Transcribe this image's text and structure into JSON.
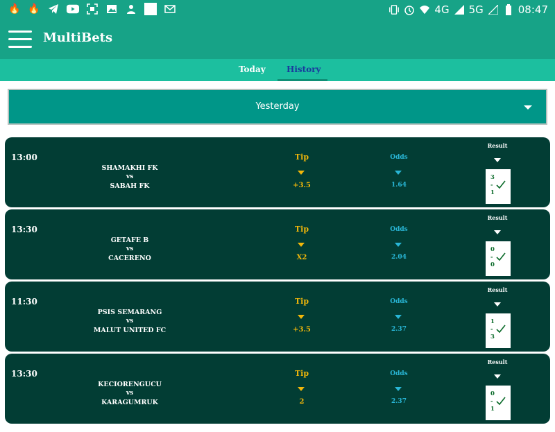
{
  "status_bar": {
    "time": "08:47",
    "network_4g": "4G",
    "network_5g": "5G"
  },
  "app_bar": {
    "title": "MultiBets"
  },
  "tabs": [
    {
      "label": "Today",
      "active": false
    },
    {
      "label": "History",
      "active": true
    }
  ],
  "date_filter": {
    "selected": "Yesterday"
  },
  "columns": {
    "tip": "Tip",
    "odds": "Odds",
    "result": "Result",
    "vs": "vs"
  },
  "matches": [
    {
      "time": "13:00",
      "home": "SHAMAKHI FK",
      "away": "SABAH FK",
      "tip": "+3.5",
      "odds": "1.64",
      "score_home": "3",
      "score_away": "1",
      "won": true
    },
    {
      "time": "13:30",
      "home": "GETAFE B",
      "away": "CACERENO",
      "tip": "X2",
      "odds": "2.04",
      "score_home": "0",
      "score_away": "0",
      "won": true
    },
    {
      "time": "11:30",
      "home": "PSIS SEMARANG",
      "away": "MALUT UNITED FC",
      "tip": "+3.5",
      "odds": "2.37",
      "score_home": "1",
      "score_away": "3",
      "won": true
    },
    {
      "time": "13:30",
      "home": "KECIORENGUCU",
      "away": "KARAGUMRUK",
      "tip": "2",
      "odds": "2.37",
      "score_home": "0",
      "score_away": "1",
      "won": true
    }
  ],
  "colors": {
    "primary": "#17a387",
    "tab_bar": "#1cbf9f",
    "card": "#023d34",
    "tip": "#f2b70a",
    "odds": "#29b6d6",
    "win": "#0b6b2a"
  }
}
